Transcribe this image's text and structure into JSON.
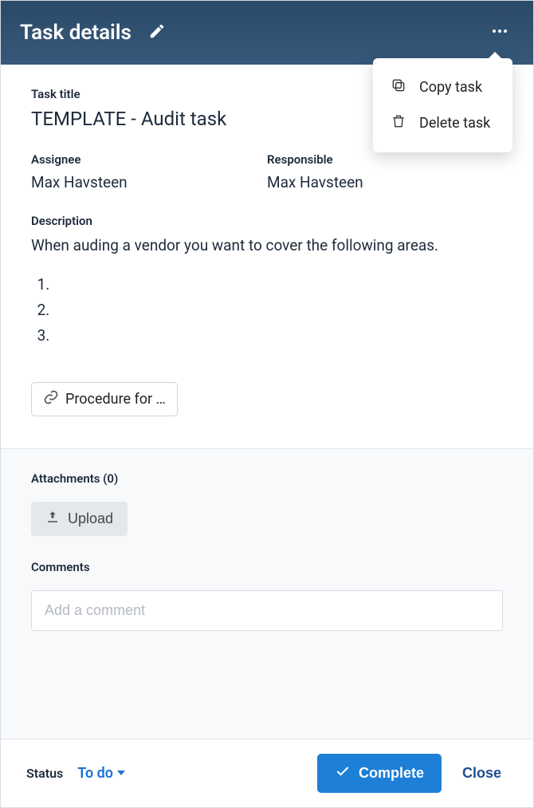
{
  "header": {
    "title": "Task details"
  },
  "menu": {
    "copy": "Copy task",
    "delete": "Delete task"
  },
  "fields": {
    "title_label": "Task title",
    "title_value": "TEMPLATE - Audit task",
    "assignee_label": "Assignee",
    "assignee_value": "Max Havsteen",
    "responsible_label": "Responsible",
    "responsible_value": "Max Havsteen",
    "description_label": "Description",
    "description_text": "When auding a vendor you want to cover the following areas.",
    "description_items": [
      "",
      "",
      ""
    ],
    "link_chip": "Procedure for …"
  },
  "attachments": {
    "label": "Attachments (0)",
    "upload": "Upload"
  },
  "comments": {
    "label": "Comments",
    "placeholder": "Add a comment"
  },
  "footer": {
    "status_label": "Status",
    "status_value": "To do",
    "complete": "Complete",
    "close": "Close"
  }
}
